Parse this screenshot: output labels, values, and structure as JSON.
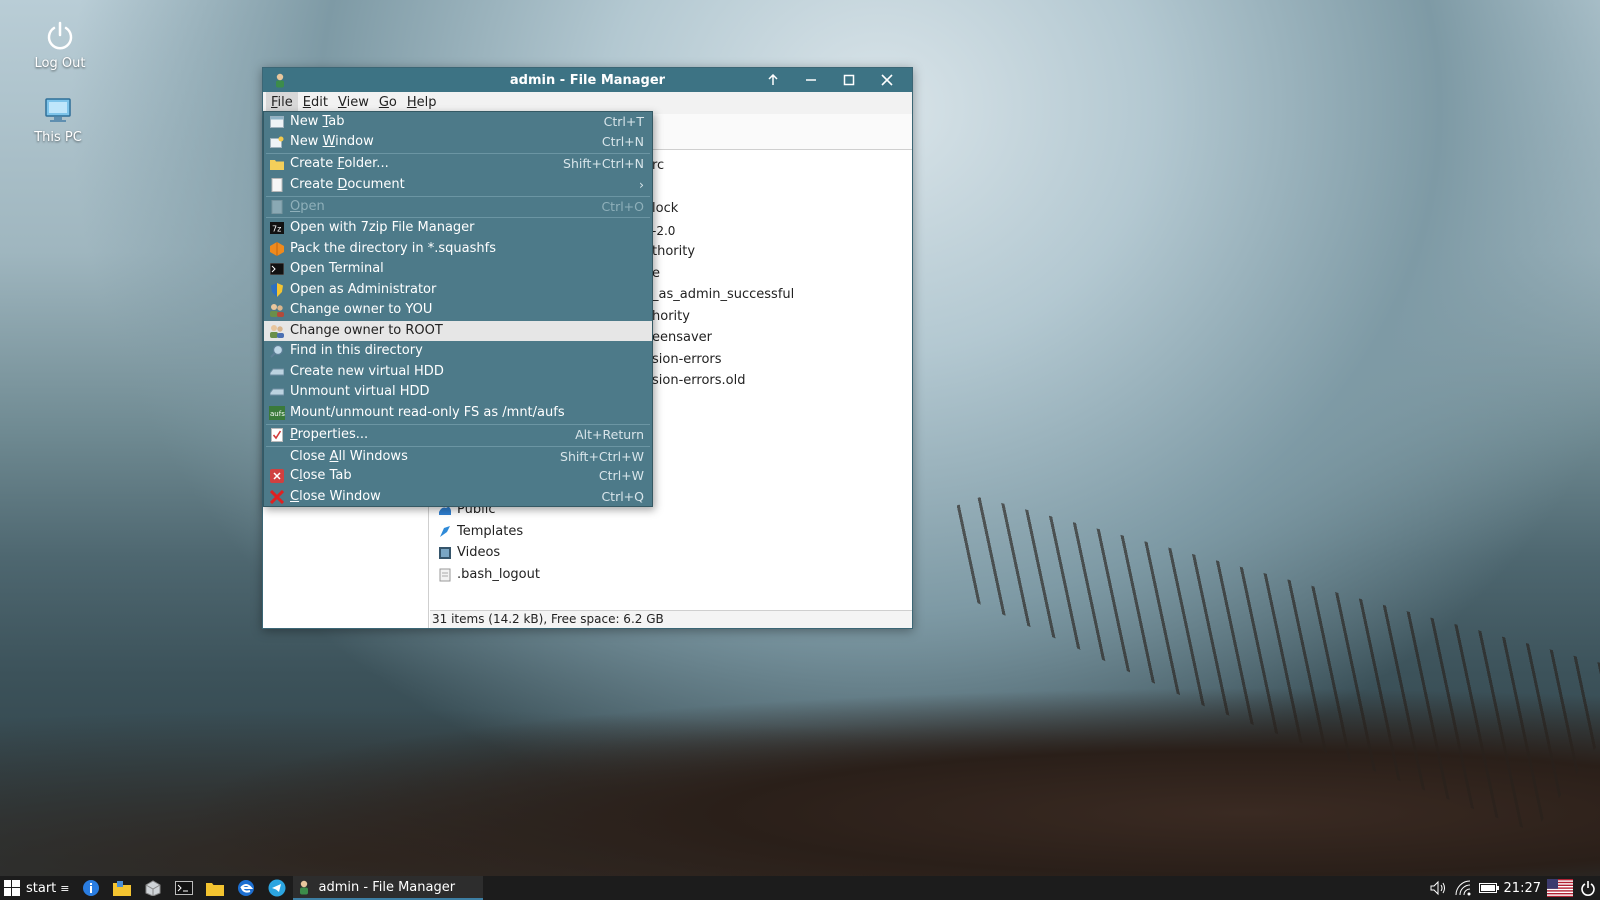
{
  "desktop": {
    "icons": [
      {
        "label": "Log Out",
        "icon": "power-icon"
      },
      {
        "label": "This PC",
        "icon": "computer-icon"
      }
    ]
  },
  "window": {
    "title": "admin - File Manager",
    "controls": [
      "up-arrow-icon",
      "minimize-icon",
      "maximize-icon",
      "close-icon"
    ],
    "menubar": [
      {
        "label": "File",
        "u": "F",
        "rest": "ile"
      },
      {
        "label": "Edit",
        "u": "E",
        "rest": "dit"
      },
      {
        "label": "View",
        "u": "V",
        "rest": "iew"
      },
      {
        "label": "Go",
        "u": "G",
        "rest": "o"
      },
      {
        "label": "Help",
        "u": "H",
        "rest": "elp"
      }
    ],
    "visible_file_fragments": [
      "rc",
      "lock",
      "-2.0",
      "thority",
      "e",
      "_as_admin_successful",
      "hority",
      "eensaver",
      "sion-errors",
      "sion-errors.old"
    ],
    "files": [
      {
        "name": "Public",
        "icon": "folder-public-icon"
      },
      {
        "name": "Templates",
        "icon": "folder-templates-icon"
      },
      {
        "name": "Videos",
        "icon": "folder-videos-icon"
      },
      {
        "name": ".bash_logout",
        "icon": "text-file-icon"
      }
    ],
    "status": "31 items (14.2 kB), Free space: 6.2 GB"
  },
  "file_menu": {
    "items": [
      {
        "pre": "New ",
        "u": "T",
        "post": "ab",
        "accel": "Ctrl+T",
        "icon": "new-tab-icon",
        "state": "normal"
      },
      {
        "pre": "New ",
        "u": "W",
        "post": "indow",
        "accel": "Ctrl+N",
        "icon": "new-window-icon",
        "state": "normal"
      },
      {
        "pre": "Create ",
        "u": "F",
        "post": "older...",
        "accel": "Shift+Ctrl+N",
        "icon": "folder-icon",
        "state": "normal"
      },
      {
        "pre": "Create ",
        "u": "D",
        "post": "ocument",
        "accel": "›",
        "icon": "document-icon",
        "state": "normal"
      },
      {
        "pre": "",
        "u": "O",
        "post": "pen",
        "accel": "Ctrl+O",
        "icon": "open-icon",
        "state": "disabled"
      },
      {
        "pre": "Open with 7zip File Manager",
        "u": "",
        "post": "",
        "accel": "",
        "icon": "7zip-icon",
        "state": "normal"
      },
      {
        "pre": "Pack the directory in *.squashfs",
        "u": "",
        "post": "",
        "accel": "",
        "icon": "package-icon",
        "state": "normal"
      },
      {
        "pre": "Open Terminal",
        "u": "",
        "post": "",
        "accel": "",
        "icon": "terminal-icon",
        "state": "normal"
      },
      {
        "pre": "Open as Administrator",
        "u": "",
        "post": "",
        "accel": "",
        "icon": "shield-icon",
        "state": "normal"
      },
      {
        "pre": "Change owner to YOU",
        "u": "",
        "post": "",
        "accel": "",
        "icon": "users-icon",
        "state": "normal"
      },
      {
        "pre": "Change owner to ROOT",
        "u": "",
        "post": "",
        "accel": "",
        "icon": "users-icon",
        "state": "hover"
      },
      {
        "pre": "Find in this directory",
        "u": "",
        "post": "",
        "accel": "",
        "icon": "search-icon",
        "state": "normal"
      },
      {
        "pre": "Create new virtual HDD",
        "u": "",
        "post": "",
        "accel": "",
        "icon": "hdd-icon",
        "state": "normal"
      },
      {
        "pre": "Unmount virtual HDD",
        "u": "",
        "post": "",
        "accel": "",
        "icon": "hdd-icon",
        "state": "normal"
      },
      {
        "pre": "Mount/unmount read-only FS as /mnt/aufs",
        "u": "",
        "post": "",
        "accel": "",
        "icon": "aufs-icon",
        "state": "normal"
      },
      {
        "pre": "",
        "u": "P",
        "post": "roperties...",
        "accel": "Alt+Return",
        "icon": "properties-icon",
        "state": "normal"
      },
      {
        "pre": "Close ",
        "u": "A",
        "post": "ll Windows",
        "accel": "Shift+Ctrl+W",
        "icon": "",
        "state": "normal"
      },
      {
        "pre": "C",
        "u": "l",
        "post": "ose Tab",
        "accel": "Ctrl+W",
        "icon": "close-tab-icon",
        "state": "normal"
      },
      {
        "pre": "",
        "u": "C",
        "post": "lose Window",
        "accel": "Ctrl+Q",
        "icon": "close-window-icon",
        "state": "normal"
      }
    ]
  },
  "taskbar": {
    "start_label": "start",
    "task_label": "admin - File Manager",
    "clock": "21:27",
    "quick_launch": [
      "info-icon",
      "file-manager-icon",
      "package-manager-icon",
      "terminal-icon",
      "folder-icon",
      "browser-icon",
      "telegram-icon"
    ],
    "tray": [
      "volume-icon",
      "network-icon",
      "battery-icon",
      "flag-us-icon",
      "power-icon"
    ]
  }
}
